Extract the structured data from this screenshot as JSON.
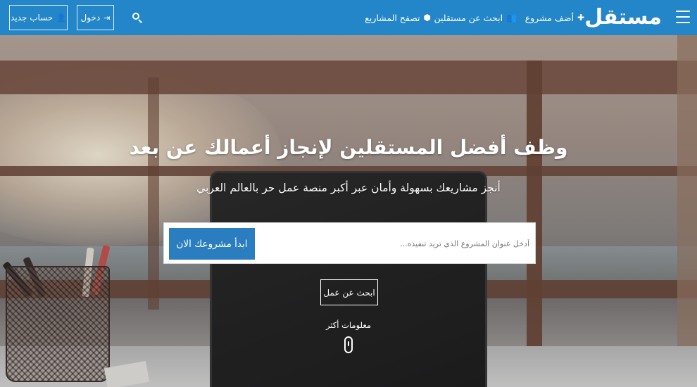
{
  "header": {
    "logo": "مستقل",
    "nav": {
      "add_project": "أضف مشروع",
      "find_freelancers": "ابحث عن مستقلين",
      "browse_projects": "تصفح المشاريع"
    },
    "login_label": "دخول",
    "signup_label": "حساب جديد"
  },
  "hero": {
    "title": "وظف أفضل المستقلين لإنجاز أعمالك عن بعد",
    "subtitle": "أنجز مشاريعك بسهولة وأمان عبر أكبر منصة عمل حر بالعالم العربي",
    "project_placeholder": "أدخل عنوان المشروع الذي تريد تنفيذه...",
    "start_button": "ابدأ مشروعك الان",
    "find_work_button": "ابحث عن عمل",
    "more_info": "معلومات أكثر"
  },
  "colors": {
    "primary": "#2386c8",
    "button": "#2a7ec0"
  },
  "icons": {
    "menu": "hamburger-icon",
    "add": "plus-icon",
    "find": "users-icon",
    "browse": "cubes-icon",
    "search": "search-icon",
    "login": "sign-in-icon",
    "signup": "user-plus-icon",
    "scroll": "mouse-icon"
  }
}
